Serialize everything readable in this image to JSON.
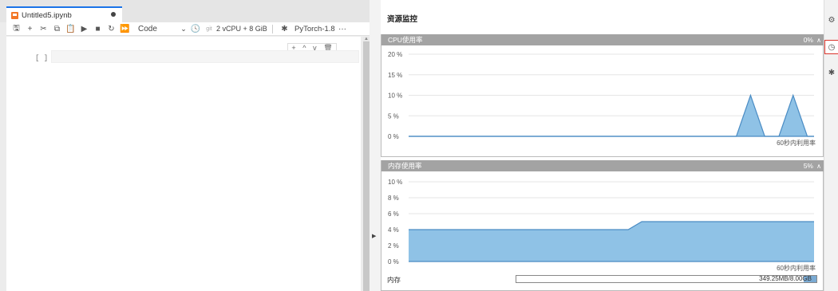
{
  "notebook": {
    "tab_title": "Untitled5.ipynb",
    "cell_type": "Code",
    "git_label": "git",
    "resources_label": "2 vCPU + 8 GiB",
    "kernel_name": "PyTorch-1.8",
    "more_label": "···",
    "cell_prompt": "[ ]",
    "cell_tools": [
      "+",
      "^",
      "v",
      "🗑"
    ]
  },
  "panel": {
    "title": "资源监控",
    "cpu": {
      "header": "CPU使用率",
      "value": "0%",
      "caption": "60秒内利用率"
    },
    "memory": {
      "header": "内存使用率",
      "value": "5%",
      "caption": "60秒内利用率",
      "row_label": "内存",
      "usage_text": "349.25MB/8.00GB",
      "usage_fraction": 0.0426
    }
  },
  "chart_data": [
    {
      "type": "area",
      "title": "CPU使用率",
      "xlabel": "60秒内利用率",
      "ylabel": "",
      "y_ticks": [
        "20 %",
        "15 %",
        "10 %",
        "5 %",
        "0 %"
      ],
      "ylim": [
        0,
        20
      ],
      "x": [
        0,
        50,
        52,
        54,
        56,
        58,
        60
      ],
      "series": [
        {
          "values": [
            0,
            0,
            10,
            0,
            0,
            10,
            0
          ]
        }
      ],
      "x_points": [
        0,
        48.5,
        50.6,
        52.7,
        54.8,
        56.9,
        59.0,
        60
      ],
      "y_points": [
        0,
        0,
        10,
        0,
        0,
        10,
        0,
        0
      ],
      "grid": true,
      "color": "#8fc2e6"
    },
    {
      "type": "area",
      "title": "内存使用率",
      "xlabel": "60秒内利用率",
      "ylabel": "",
      "y_ticks": [
        "10 %",
        "8 %",
        "6 %",
        "4 %",
        "2 %",
        "0 %"
      ],
      "ylim": [
        0,
        10
      ],
      "x_points": [
        0,
        32.5,
        34.5,
        60
      ],
      "y_points": [
        4,
        4,
        5,
        5
      ],
      "grid": true,
      "color": "#8fc2e6"
    }
  ]
}
